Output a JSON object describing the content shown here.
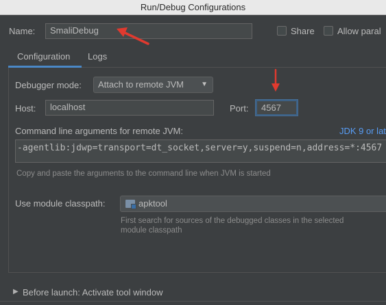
{
  "window": {
    "title": "Run/Debug Configurations"
  },
  "name_row": {
    "label": "Name:",
    "value": "SmaliDebug",
    "share_label": "Share",
    "allow_parallel_label": "Allow paral"
  },
  "tabs": [
    {
      "label": "Configuration",
      "active": true
    },
    {
      "label": "Logs",
      "active": false
    }
  ],
  "config": {
    "debugger_mode_label": "Debugger mode:",
    "debugger_mode_value": "Attach to remote JVM",
    "host_label": "Host:",
    "host_value": "localhost",
    "port_label": "Port:",
    "port_value": "4567",
    "cmd_label": "Command line arguments for remote JVM:",
    "jdk_link": "JDK 9 or lat",
    "cmd_value": "-agentlib:jdwp=transport=dt_socket,server=y,suspend=n,address=*:4567",
    "cmd_hint": "Copy and paste the arguments to the command line when JVM is started",
    "module_label": "Use module classpath:",
    "module_value": "apktool",
    "module_hint_1": "First search for sources of the debugged classes in the selected",
    "module_hint_2": "module classpath"
  },
  "before_launch": {
    "label": "Before launch: Activate tool window"
  },
  "colors": {
    "accent": "#4a88c7",
    "annotation_arrow": "#e03a2f",
    "background": "#3c3f41",
    "link": "#589df6"
  }
}
